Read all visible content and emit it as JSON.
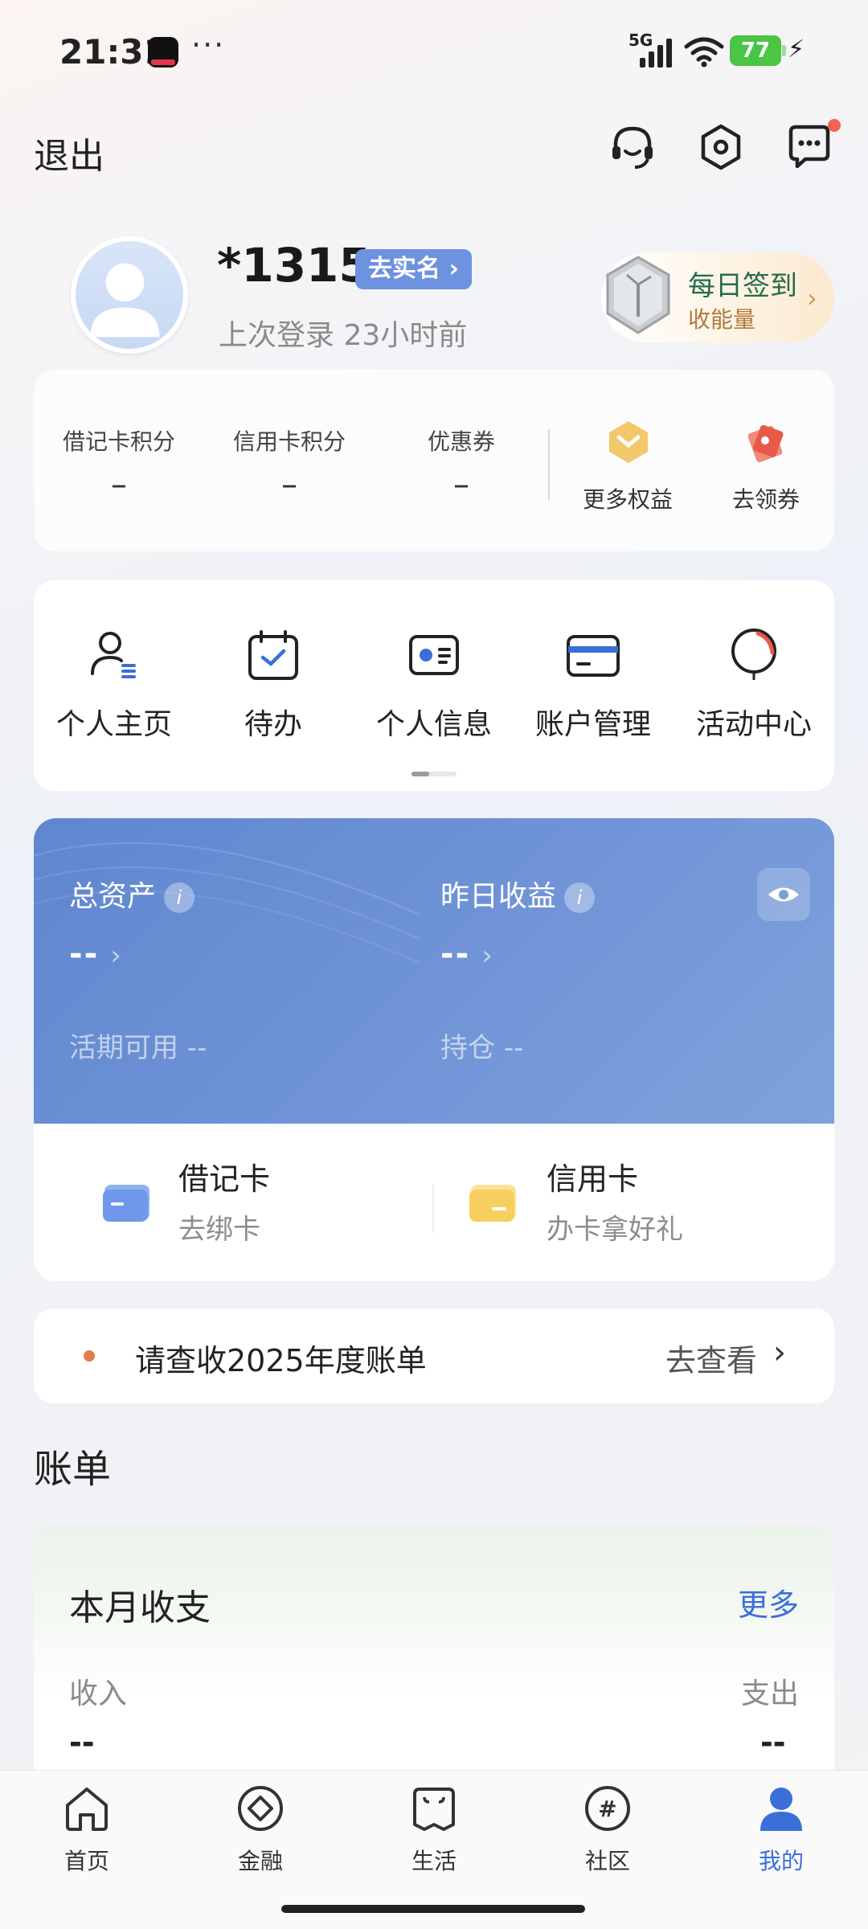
{
  "status_bar": {
    "time": "21:31",
    "network": "5G",
    "battery": "77"
  },
  "top_nav": {
    "logout_label": "退出"
  },
  "profile": {
    "username": "*1315",
    "verify_badge": "去实名 ›",
    "last_login": "上次登录 23小时前"
  },
  "checkin": {
    "title": "每日签到",
    "subtitle": "收能量"
  },
  "points": {
    "items": [
      {
        "label": "借记卡积分",
        "value": "–"
      },
      {
        "label": "信用卡积分",
        "value": "–"
      },
      {
        "label": "优惠券",
        "value": "–"
      }
    ],
    "perks": [
      {
        "label": "更多权益"
      },
      {
        "label": "去领券"
      }
    ]
  },
  "shortcuts": [
    {
      "label": "个人主页",
      "icon": "person-icon"
    },
    {
      "label": "待办",
      "icon": "calendar-check-icon"
    },
    {
      "label": "个人信息",
      "icon": "id-card-icon"
    },
    {
      "label": "账户管理",
      "icon": "card-icon"
    },
    {
      "label": "活动中心",
      "icon": "balloon-icon"
    }
  ],
  "assets": {
    "total_label": "总资产",
    "total_value": "--",
    "yesterday_label": "昨日收益",
    "yesterday_value": "--",
    "current_label": "活期可用 --",
    "holding_label": "持仓 --",
    "info_glyph": "i"
  },
  "cards": {
    "debit": {
      "title": "借记卡",
      "sub": "去绑卡"
    },
    "credit": {
      "title": "信用卡",
      "sub": "办卡拿好礼"
    }
  },
  "notice": {
    "text": "请查收2025年度账单",
    "action": "去查看"
  },
  "bill": {
    "section_title": "账单",
    "card_title": "本月收支",
    "more": "更多",
    "income_label": "收入",
    "expense_label": "支出",
    "income_value": "--",
    "expense_value": "--"
  },
  "tabbar": [
    {
      "label": "首页",
      "icon": "home-icon"
    },
    {
      "label": "金融",
      "icon": "finance-icon"
    },
    {
      "label": "生活",
      "icon": "life-icon"
    },
    {
      "label": "社区",
      "icon": "community-icon"
    },
    {
      "label": "我的",
      "icon": "profile-icon",
      "active": true
    }
  ],
  "colors": {
    "accent": "#3a6fd8",
    "asset_card": "#6a8fd4",
    "notice_dot": "#e67a4e"
  }
}
